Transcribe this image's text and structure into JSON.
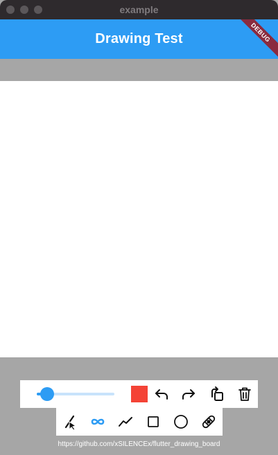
{
  "window": {
    "title": "example"
  },
  "appbar": {
    "title": "Drawing Test",
    "debug_banner": "DEBUG"
  },
  "colors": {
    "accent": "#2d9cf4",
    "pen_color": "#f44336",
    "background": "#a6a6a6"
  },
  "toolbar_top": {
    "stroke_width_slider": {
      "value_fraction": 0.13
    },
    "color_swatch": "#f44336",
    "icons": [
      "undo-icon",
      "redo-icon",
      "rotate-icon",
      "delete-icon"
    ]
  },
  "toolbar_bottom": {
    "tools": [
      {
        "icon": "pen-icon",
        "selected": false
      },
      {
        "icon": "infinity-icon",
        "selected": true
      },
      {
        "icon": "polyline-icon",
        "selected": false
      },
      {
        "icon": "square-icon",
        "selected": false
      },
      {
        "icon": "circle-icon",
        "selected": false
      },
      {
        "icon": "eraser-icon",
        "selected": false
      }
    ]
  },
  "footer": {
    "link_text": "https://github.com/xSILENCEx/flutter_drawing_board"
  }
}
